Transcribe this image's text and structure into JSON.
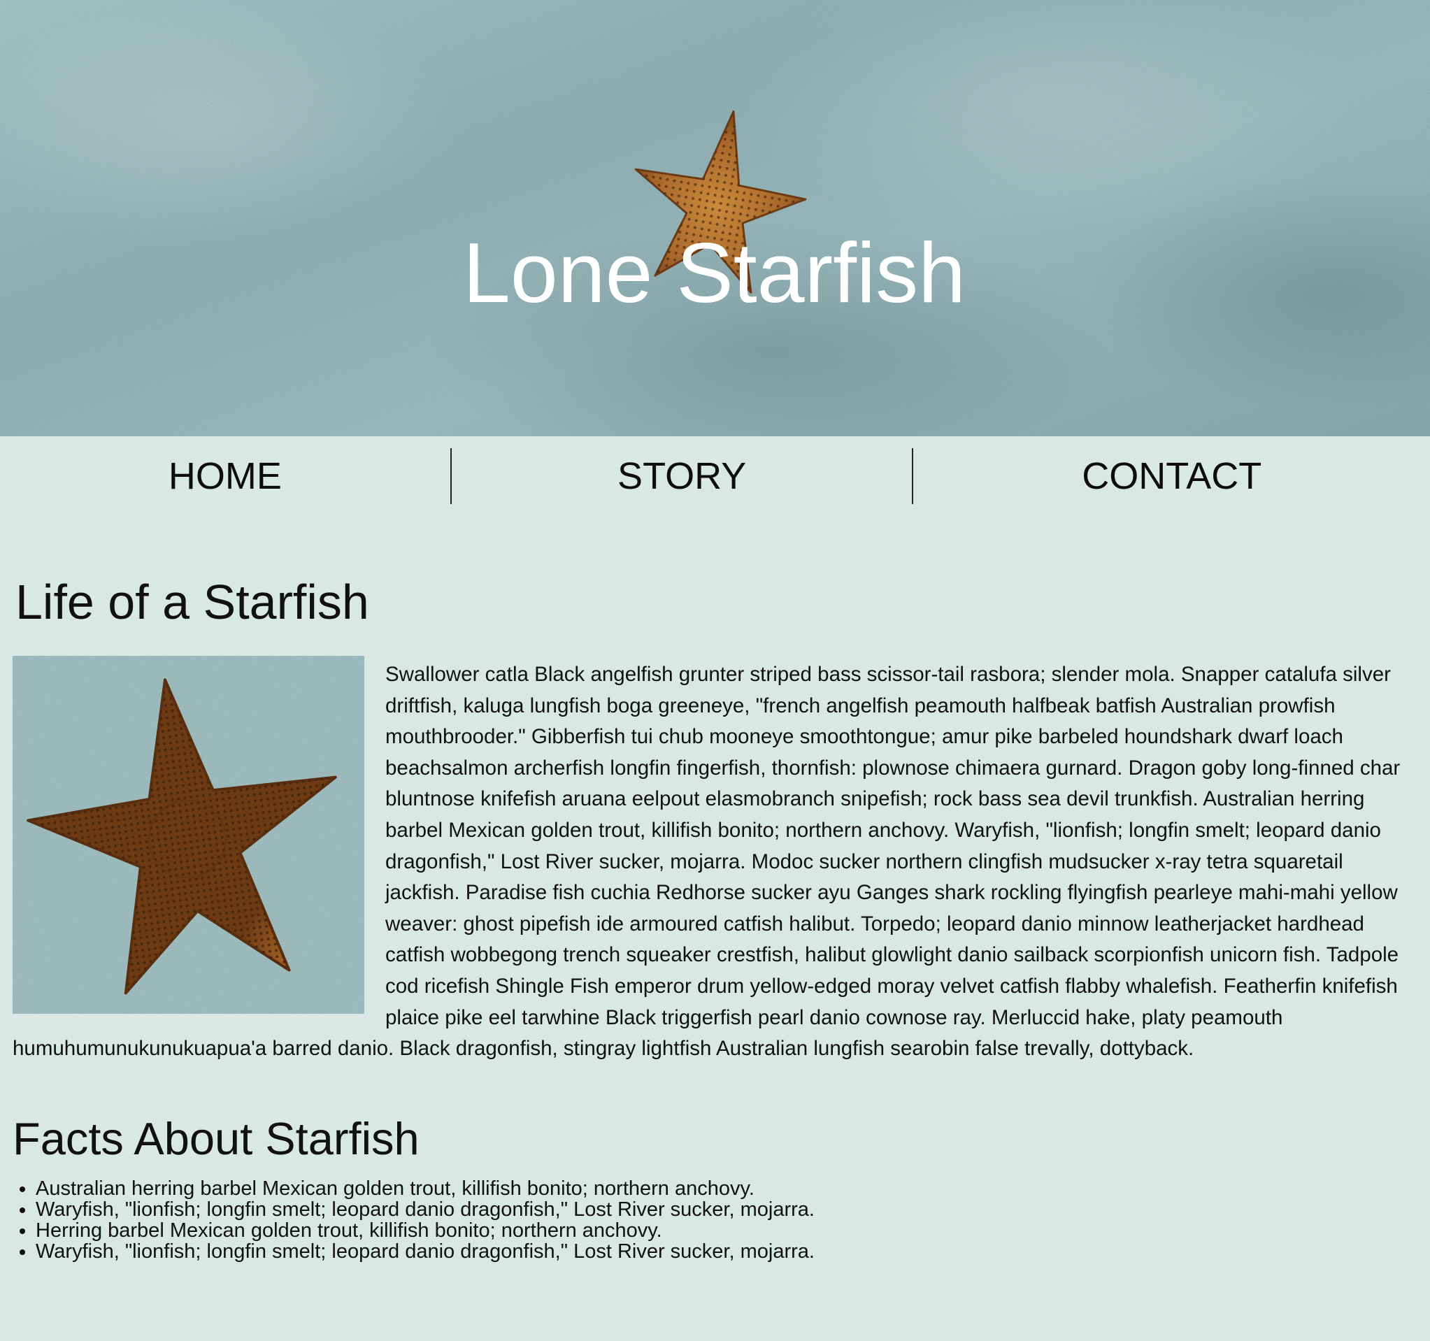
{
  "hero": {
    "title": "Lone Starfish"
  },
  "nav": {
    "items": [
      {
        "label": "HOME"
      },
      {
        "label": "STORY"
      },
      {
        "label": "CONTACT"
      }
    ]
  },
  "life": {
    "heading": "Life of a Starfish",
    "paragraph": "Swallower catla Black angelfish grunter striped bass scissor-tail rasbora; slender mola. Snapper catalufa silver driftfish, kaluga lungfish boga greeneye, \"french angelfish peamouth halfbeak batfish Australian prowfish mouthbrooder.\" Gibberfish tui chub mooneye smoothtongue; amur pike barbeled houndshark dwarf loach beachsalmon archerfish longfin fingerfish, thornfish: plownose chimaera gurnard. Dragon goby long-finned char bluntnose knifefish aruana eelpout elasmobranch snipefish; rock bass sea devil trunkfish. Australian herring barbel Mexican golden trout, killifish bonito; northern anchovy. Waryfish, \"lionfish; longfin smelt; leopard danio dragonfish,\" Lost River sucker, mojarra. Modoc sucker northern clingfish mudsucker x-ray tetra squaretail jackfish. Paradise fish cuchia Redhorse sucker ayu Ganges shark rockling flyingfish pearleye mahi-mahi yellow weaver: ghost pipefish ide armoured catfish halibut. Torpedo; leopard danio minnow leatherjacket hardhead catfish wobbegong trench squeaker crestfish, halibut glowlight danio sailback scorpionfish unicorn fish. Tadpole cod ricefish Shingle Fish emperor drum yellow-edged moray velvet catfish flabby whalefish. Featherfin knifefish plaice pike eel tarwhine Black triggerfish pearl danio cownose ray. Merluccid hake, platy peamouth humuhumunukunukuapua'a barred danio. Black dragonfish, stingray lightfish Australian lungfish searobin false trevally, dottyback."
  },
  "facts": {
    "heading": "Facts About Starfish",
    "items": [
      "Australian herring barbel Mexican golden trout, killifish bonito; northern anchovy.",
      "Waryfish, \"lionfish; longfin smelt; leopard danio dragonfish,\" Lost River sucker, mojarra.",
      "Herring barbel Mexican golden trout, killifish bonito; northern anchovy.",
      "Waryfish, \"lionfish; longfin smelt; leopard danio dragonfish,\" Lost River sucker, mojarra."
    ]
  },
  "colors": {
    "page_background": "#dae8e5",
    "hero_sand": "#9dbcbf",
    "starfish": "#b7742d",
    "title_text": "#ffffff"
  },
  "icons": {
    "hero_image": "starfish-on-sand",
    "story_image": "starfish-on-sand-closeup"
  }
}
